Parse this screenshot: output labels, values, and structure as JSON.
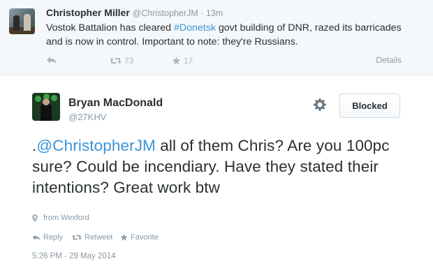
{
  "parent_tweet": {
    "display_name": "Christopher Miller",
    "handle": "@ChristopherJM",
    "time_sep": "·",
    "time": "13m",
    "text_before": "Vostok Battalion has cleared ",
    "hashtag": "#Donetsk",
    "text_after": " govt building of DNR, razed its barricades and is now in control. Important to note: they're Russians.",
    "retweet_count": "73",
    "favorite_count": "17",
    "details_label": "Details"
  },
  "main_tweet": {
    "display_name": "Bryan MacDonald",
    "handle": "@27KHV",
    "blocked_label": "Blocked",
    "text_prefix": ".",
    "mention": "@ChristopherJM",
    "text_after": " all of them Chris? Are you 100pc sure? Could be incendiary. Have they stated their intentions? Great work btw",
    "place": "from Wexford",
    "reply_label": "Reply",
    "retweet_label": "Retweet",
    "favorite_label": "Favorite",
    "timestamp": "5:26 PM - 29 May 2014"
  },
  "icons": {
    "reply": "reply-icon",
    "retweet": "retweet-icon",
    "favorite": "star-icon",
    "gear": "gear-icon",
    "location": "location-pin-icon"
  },
  "colors": {
    "link": "#3b94d9",
    "muted": "#8899a6",
    "text": "#292f33"
  }
}
